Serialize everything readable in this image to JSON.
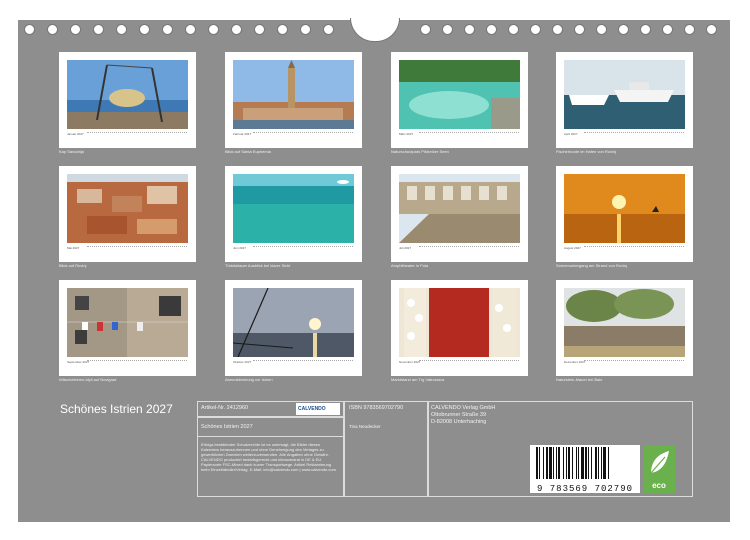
{
  "calendar": {
    "months": [
      {
        "label": "Januar 2027",
        "caption": "Kap Savudrija"
      },
      {
        "label": "Februar 2027",
        "caption": "Blick auf Santa Euphemia"
      },
      {
        "label": "März 2027",
        "caption": "Naturschutzpark Pišlevičer Seen"
      },
      {
        "label": "April 2027",
        "caption": "Fischerboote im Hafen von Rovinj"
      },
      {
        "label": "Mai 2027",
        "caption": "Blick auf Rovinj"
      },
      {
        "label": "Juni 2027",
        "caption": "Türkisblauer Ausblick bei klarer Sicht"
      },
      {
        "label": "Juli 2027",
        "caption": "Amphitheater in Pula"
      },
      {
        "label": "August 2027",
        "caption": "Sonnenuntergang am Strand von Rovinj"
      },
      {
        "label": "September 2027",
        "caption": "Wäscheleinen-Idyll auf Novigrad"
      },
      {
        "label": "Oktober 2027",
        "caption": "Abendstimmung vor Istrien"
      },
      {
        "label": "November 2027",
        "caption": "Marktstand am Trg Vatroslava"
      },
      {
        "label": "Dezember 2027",
        "caption": "Naturstein-Mauer bei Bale"
      }
    ]
  },
  "info": {
    "title": "Schönes Istrien 2027",
    "article_no": "Artikel-Nr. 2412960",
    "product_title": "Schönes Istrien 2027",
    "isbn": "ISBN 9783569702790",
    "author": "Tina Neudecker",
    "publisher_lines": [
      "CALVENDO Verlag GmbH",
      "Ottobrunner Straße 39",
      "D-82008 Unterhaching"
    ],
    "logo_text": "CALVENDO",
    "fine_print": "Erfolgs bestätender Schutzrechte ist es untersagt, die Bilder dieses Kalenders herauszutrennen und ohne Genehmigung des Verlages zu gewerblichen Zwecken weiterzuverwenden. Alle Angaben ohne Gewähr. CALVENDO produziert bedarfsgerecht und klimaneutral in DE & EU. Papiersorte FSC-Mixed dank kurzer Transportwege. Artikel Reklamierung beim Einzelhändler/Verlag. E-Mail: info@calvendo.com | www.calvendo.com",
    "barcode_number": "9 783569 702790",
    "eco_label": "eco"
  }
}
